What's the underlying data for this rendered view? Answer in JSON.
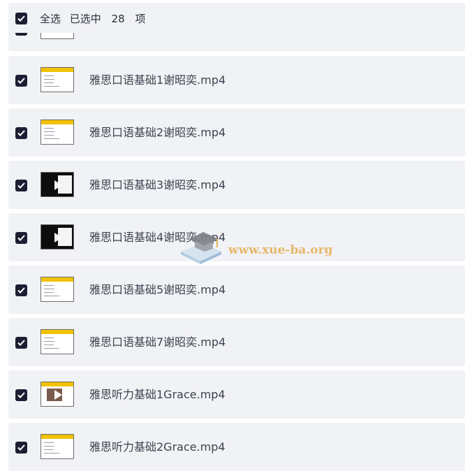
{
  "header": {
    "select_all_label": "全选",
    "selected_prefix": "已选中",
    "selected_count": "28",
    "selected_suffix": "项",
    "checked": true
  },
  "files": [
    {
      "name": "雅思口语基础1谢昭奕.mp4",
      "thumb": "yellow-slide"
    },
    {
      "name": "雅思口语基础2谢昭奕.mp4",
      "thumb": "yellow-slide"
    },
    {
      "name": "雅思口语基础3谢昭奕.mp4",
      "thumb": "dark-slide"
    },
    {
      "name": "雅思口语基础4谢昭奕.mp4",
      "thumb": "dark-slide"
    },
    {
      "name": "雅思口语基础5谢昭奕.mp4",
      "thumb": "yellow-slide"
    },
    {
      "name": "雅思口语基础7谢昭奕.mp4",
      "thumb": "yellow-slide"
    },
    {
      "name": "雅思听力基础1Grace.mp4",
      "thumb": "photo-slide"
    },
    {
      "name": "雅思听力基础2Grace.mp4",
      "thumb": "yellow-slide"
    }
  ],
  "watermark": {
    "text": "www.xue-ba.org",
    "icon": "graduation-cap-icon"
  },
  "colors": {
    "row_bg": "#f1f2f5",
    "checkbox": "#1c1f33",
    "slide_yellow": "#f2c200",
    "watermark": "#e6b25a"
  }
}
